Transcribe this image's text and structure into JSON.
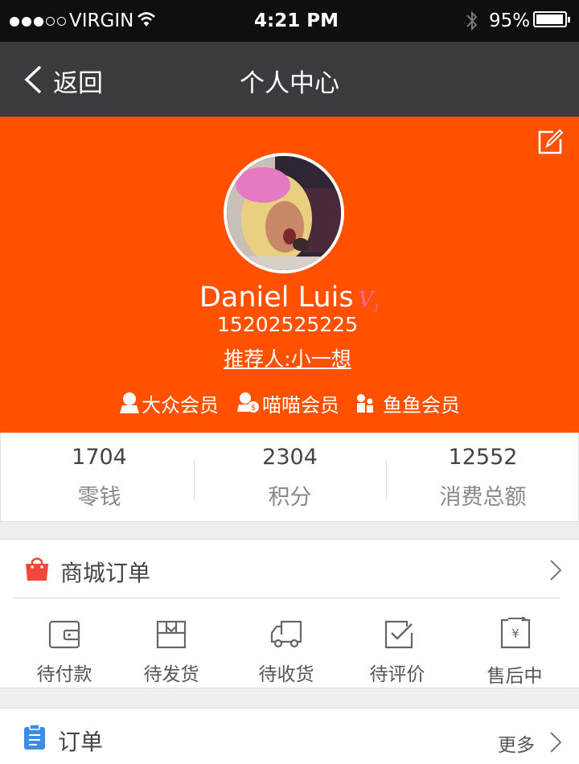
{
  "status_bar": {
    "carrier": "VIRGIN",
    "time": "4:21 PM",
    "battery": "95%",
    "signal_full": 3,
    "signal_total": 5
  },
  "nav": {
    "back_label": "返回",
    "title": "个人中心"
  },
  "profile": {
    "name": "Daniel Luis",
    "phone": "15202525225",
    "referrer": "推荐人:小一想",
    "memberships": [
      "大众会员",
      "喵喵会员",
      "鱼鱼会员"
    ]
  },
  "stats": [
    {
      "value": "1704",
      "label": "零钱"
    },
    {
      "value": "2304",
      "label": "积分"
    },
    {
      "value": "12552",
      "label": "消费总额"
    }
  ],
  "shop_orders": {
    "title": "商城订单",
    "items": [
      {
        "label": "待付款",
        "icon": "wallet-icon"
      },
      {
        "label": "待发货",
        "icon": "box-icon"
      },
      {
        "label": "待收货",
        "icon": "truck-icon"
      },
      {
        "label": "待评价",
        "icon": "check-icon"
      },
      {
        "label": "售后中",
        "icon": "yen-return-icon"
      }
    ]
  },
  "orders": {
    "title": "订单",
    "more": "更多"
  },
  "colors": {
    "accent": "#ff5100",
    "nav": "#3a3b3e",
    "status": "#0f0f0f"
  }
}
